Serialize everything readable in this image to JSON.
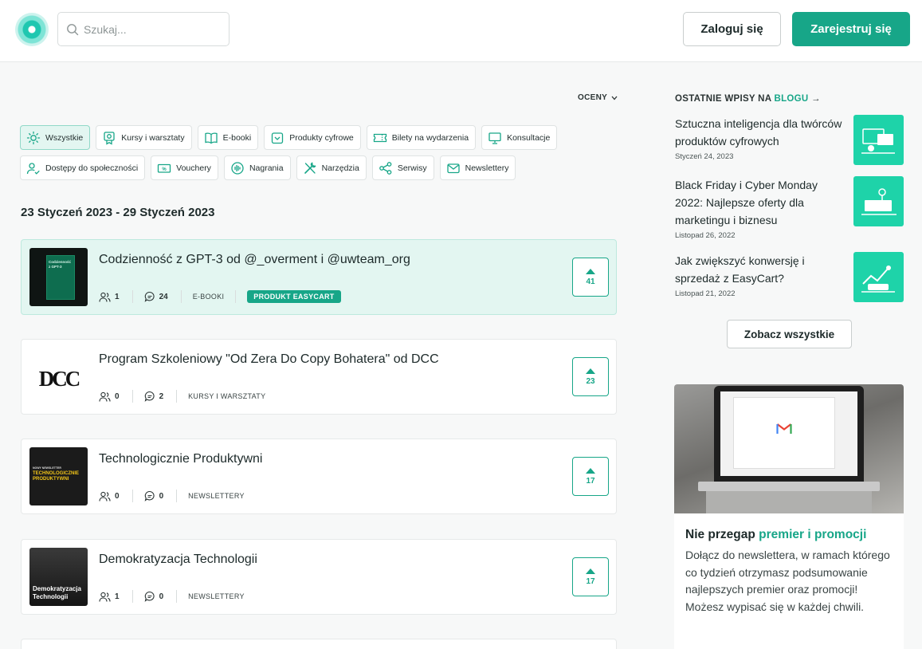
{
  "header": {
    "search_placeholder": "Szukaj...",
    "login_label": "Zaloguj się",
    "register_label": "Zarejestruj się"
  },
  "sort": {
    "label": "OCENY"
  },
  "filters": [
    {
      "label": "Wszystkie",
      "icon": "sun-icon",
      "active": true
    },
    {
      "label": "Kursy i warsztaty",
      "icon": "certificate-icon"
    },
    {
      "label": "E-booki",
      "icon": "book-icon"
    },
    {
      "label": "Produkty cyfrowe",
      "icon": "download-box-icon"
    },
    {
      "label": "Bilety na wydarzenia",
      "icon": "ticket-icon"
    },
    {
      "label": "Konsultacje",
      "icon": "presentation-icon"
    },
    {
      "label": "Dostępy do społeczności",
      "icon": "user-check-icon"
    },
    {
      "label": "Vouchery",
      "icon": "voucher-icon"
    },
    {
      "label": "Nagrania",
      "icon": "audio-wave-icon"
    },
    {
      "label": "Narzędzia",
      "icon": "tools-icon"
    },
    {
      "label": "Serwisy",
      "icon": "share-nodes-icon"
    },
    {
      "label": "Newslettery",
      "icon": "envelope-icon"
    }
  ],
  "week_label": "23 Styczeń 2023 - 29 Styczeń 2023",
  "products": [
    {
      "title": "Codzienność z GPT-3 od @_overment i @uwteam_org",
      "users": "1",
      "comments": "24",
      "category": "E-BOOKI",
      "badge": "PRODUKT EASYCART",
      "votes": "41",
      "thumb_text": "Codzienność z GPT-3"
    },
    {
      "title": "Program Szkoleniowy \"Od Zera Do Copy Bohatera\" od DCC",
      "users": "0",
      "comments": "2",
      "category": "KURSY I WARSZTATY",
      "votes": "23",
      "thumb_text": "DCC"
    },
    {
      "title": "Technologicznie Produktywni",
      "users": "0",
      "comments": "0",
      "category": "NEWSLETTERY",
      "votes": "17",
      "thumb_text": "TECHNOLOGICZNIE PRODUKTYWNI",
      "thumb_small": "NOWY NEWSLETTER"
    },
    {
      "title": "Demokratyzacja Technologii",
      "users": "1",
      "comments": "0",
      "category": "NEWSLETTERY",
      "votes": "17",
      "thumb_text": "Demokratyzacja Technologii"
    }
  ],
  "blog": {
    "heading_prefix": "OSTATNIE WPISY NA ",
    "heading_link": "BLOGU",
    "arrow": "→",
    "posts": [
      {
        "title": "Sztuczna inteligencja dla twórców produktów cyfrowych",
        "date": "Styczeń 24, 2023"
      },
      {
        "title": "Black Friday i Cyber Monday 2022: Najlepsze oferty dla marketingu i biznesu",
        "date": "Listopad 26, 2022"
      },
      {
        "title": "Jak zwiększyć konwersję i sprzedaż z EasyCart?",
        "date": "Listopad 21, 2022"
      }
    ],
    "see_all_label": "Zobacz wszystkie"
  },
  "promo": {
    "title_prefix": "Nie przegap ",
    "title_accent": "premier i promocji",
    "text": "Dołącz do newslettera, w ramach którego co tydzień otrzymasz podsumowanie najlepszych premier oraz promocji! Możesz wypisać się w każdej chwili."
  },
  "colors": {
    "accent": "#17a688",
    "featured_bg": "#e3f6f1",
    "blog_thumb": "#1ed3a9"
  }
}
